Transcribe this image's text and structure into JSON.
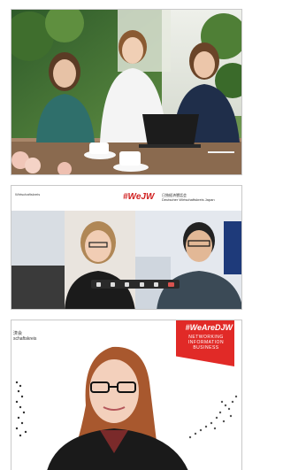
{
  "panels": {
    "office_photo": {
      "caption": ""
    },
    "video_call": {
      "hashtag": "#WeJW",
      "logo_line1": "日独経済懇話会",
      "logo_line2": "Deutscher Wirtschaftskreis Japan",
      "left_small": "Wirtschaftskreis"
    },
    "speaker": {
      "left_text": "済会\nschaftskreis",
      "flag_hashtag": "#WeAreDJW",
      "flag_line1": "NETWORKING",
      "flag_line2": "INFORMATION",
      "flag_line3": "BUSINESS"
    }
  },
  "colors": {
    "accent_red": "#e12a27",
    "border": "#c9c9c9"
  }
}
